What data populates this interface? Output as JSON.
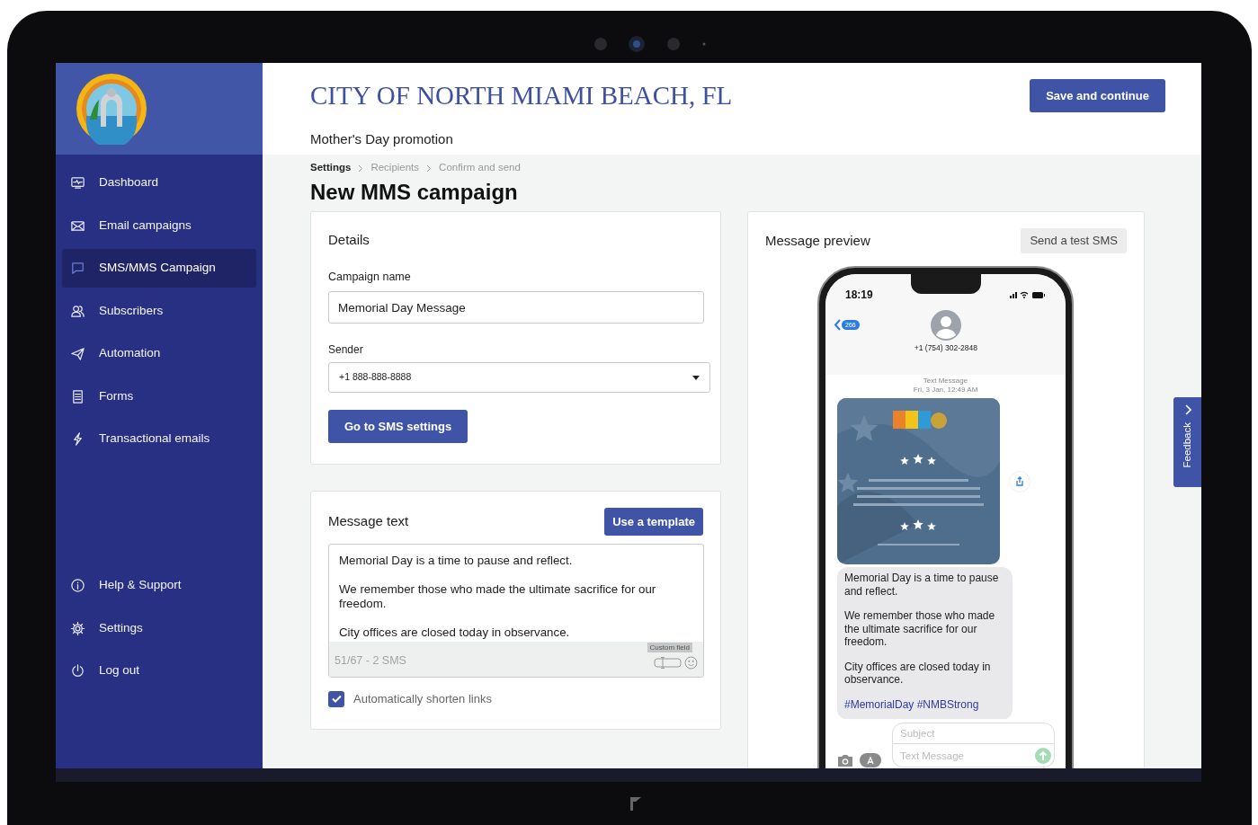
{
  "sidebar": {
    "items": [
      {
        "label": "Dashboard",
        "selected": false
      },
      {
        "label": "Email campaigns",
        "selected": false
      },
      {
        "label": "SMS/MMS Campaign",
        "selected": true
      },
      {
        "label": "Subscribers",
        "selected": false
      },
      {
        "label": "Automation",
        "selected": false
      },
      {
        "label": "Forms",
        "selected": false
      },
      {
        "label": "Transactional emails",
        "selected": false
      }
    ],
    "bottom_items": [
      {
        "label": "Help & Support",
        "selected": false
      },
      {
        "label": "Settings",
        "selected": false
      },
      {
        "label": "Log out",
        "selected": false
      }
    ]
  },
  "header": {
    "title": "CITY OF NORTH MIAMI BEACH, FL",
    "subtitle": "Mother's Day promotion",
    "save_button": "Save and continue"
  },
  "breadcrumb": [
    {
      "label": "Settings",
      "current": true
    },
    {
      "label": "Recipients",
      "current": false
    },
    {
      "label": "Confirm and send",
      "current": false
    }
  ],
  "page_title": "New MMS campaign",
  "details": {
    "title": "Details",
    "campaign_name": {
      "label": "Campaign name",
      "value": "Memorial Day Message"
    },
    "sender": {
      "label": "Sender",
      "value": "+1 888-888-8888"
    },
    "button": "Go to SMS settings"
  },
  "message": {
    "title": "Message text",
    "template_button": "Use a template",
    "value": "Memorial Day is a time to pause and reflect.\n\nWe remember those who made the ultimate sacrifice for our freedom.\n\nCity offices are closed today in observance.",
    "counter": "51/67 - 2 SMS",
    "tooltip": "Custom field",
    "shorten_links": {
      "label": "Automatically shorten links",
      "checked": true
    }
  },
  "preview": {
    "title": "Message preview",
    "test_button": "Send a test SMS",
    "phone": {
      "time": "18:19",
      "back_count": "266",
      "contact": "+1 (754) 302-2848",
      "meta": [
        "Text Message",
        "Fri, 3 Jan, 12:49 AM"
      ],
      "image": {
        "kind": "picture"
      },
      "bubble": [
        "Memorial Day is a time to pause and reflect.",
        "We remember those who made the ultimate sacrifice for our freedom.",
        "City offices are closed today in observance."
      ],
      "hashtags": "#MemorialDay #NMBStrong",
      "subject_placeholder": "Subject",
      "message_placeholder": "Text Message"
    }
  },
  "feedback": "Feedback"
}
